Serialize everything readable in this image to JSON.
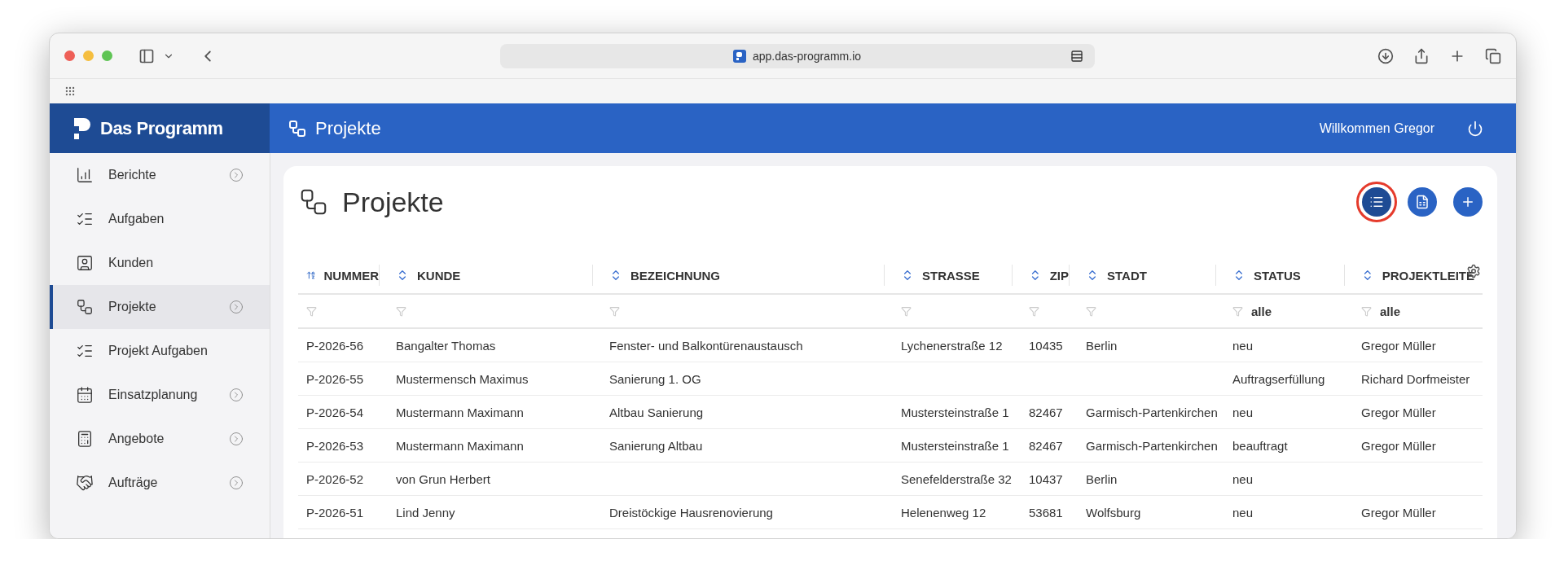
{
  "browser": {
    "url": "app.das-programm.io"
  },
  "app": {
    "logo_text": "Das Programm",
    "header_title": "Projekte",
    "welcome": "Willkommen Gregor"
  },
  "sidebar": {
    "items": [
      {
        "label": "Berichte",
        "submenu": true,
        "selected": false
      },
      {
        "label": "Aufgaben",
        "submenu": false,
        "selected": false
      },
      {
        "label": "Kunden",
        "submenu": false,
        "selected": false
      },
      {
        "label": "Projekte",
        "submenu": true,
        "selected": true
      },
      {
        "label": "Projekt Aufgaben",
        "submenu": false,
        "selected": false
      },
      {
        "label": "Einsatzplanung",
        "submenu": true,
        "selected": false
      },
      {
        "label": "Angebote",
        "submenu": true,
        "selected": false
      },
      {
        "label": "Aufträge",
        "submenu": true,
        "selected": false
      }
    ]
  },
  "page": {
    "title": "Projekte",
    "actions": [
      {
        "kind": "columns",
        "highlighted": true
      },
      {
        "kind": "excel",
        "highlighted": false
      },
      {
        "kind": "add",
        "highlighted": false
      }
    ]
  },
  "table": {
    "columns": [
      {
        "label": "NUMMER",
        "sorted": true
      },
      {
        "label": "KUNDE",
        "sorted": false
      },
      {
        "label": "BEZEICHNUNG",
        "sorted": false
      },
      {
        "label": "STRASSE",
        "sorted": false
      },
      {
        "label": "ZIP",
        "sorted": false
      },
      {
        "label": "STADT",
        "sorted": false
      },
      {
        "label": "STATUS",
        "sorted": false,
        "filter": "alle"
      },
      {
        "label": "PROJEKTLEITE",
        "sorted": false,
        "filter": "alle"
      }
    ],
    "rows": [
      [
        "P-2026-56",
        "Bangalter Thomas",
        "Fenster- und Balkontürenaustausch",
        "Lychenerstraße 12",
        "10435",
        "Berlin",
        "neu",
        "Gregor Müller"
      ],
      [
        "P-2026-55",
        "Mustermensch Maximus",
        "Sanierung 1. OG",
        null,
        null,
        null,
        "Auftragserfüllung",
        "Richard Dorfmeister"
      ],
      [
        "P-2026-54",
        "Mustermann Maximann",
        "Altbau Sanierung",
        "Mustersteinstraße 1",
        "82467",
        "Garmisch-Partenkirchen",
        "neu",
        "Gregor Müller"
      ],
      [
        "P-2026-53",
        "Mustermann Maximann",
        "Sanierung Altbau",
        "Mustersteinstraße 1",
        "82467",
        "Garmisch-Partenkirchen",
        "beauftragt",
        "Gregor Müller"
      ],
      [
        "P-2026-52",
        "von Grun Herbert",
        null,
        "Senefelderstraße 32",
        "10437",
        "Berlin",
        "neu",
        null
      ],
      [
        "P-2026-51",
        "Lind Jenny",
        "Dreistöckige Hausrenovierung",
        "Helenenweg 12",
        "53681",
        "Wolfsburg",
        "neu",
        "Gregor Müller"
      ]
    ]
  }
}
